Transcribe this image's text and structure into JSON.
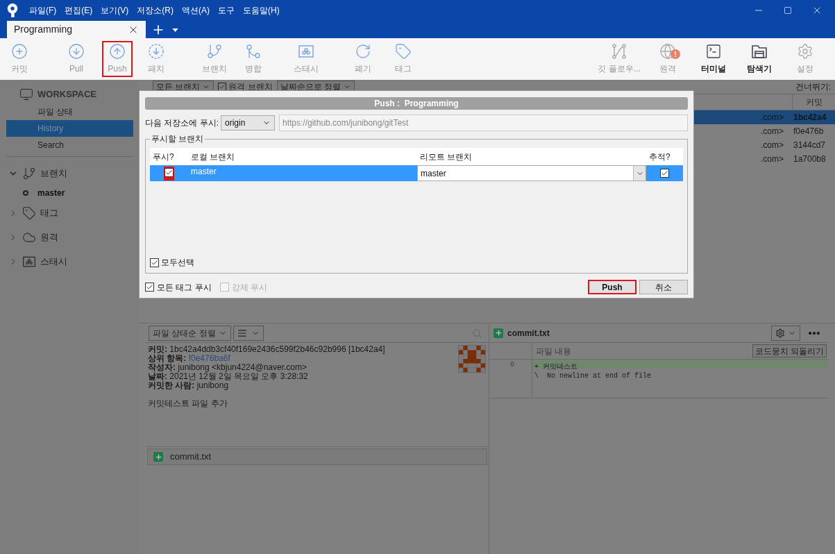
{
  "menu": [
    "파일(F)",
    "편집(E)",
    "보기(V)",
    "저장소(R)",
    "액션(A)",
    "도구",
    "도움말(H)"
  ],
  "tab": {
    "label": "Programming"
  },
  "toolbar": {
    "left": [
      {
        "kind": "commit",
        "label": "커밋",
        "active": false,
        "marked": false
      },
      {
        "kind": "pull",
        "label": "Pull",
        "active": false,
        "marked": false
      },
      {
        "kind": "push",
        "label": "Push",
        "active": false,
        "marked": true
      },
      {
        "kind": "fetch",
        "label": "패치",
        "active": false,
        "marked": false
      },
      {
        "kind": "branch",
        "label": "브랜치",
        "active": false,
        "marked": false
      },
      {
        "kind": "merge",
        "label": "병합",
        "active": false,
        "marked": false
      },
      {
        "kind": "stash",
        "label": "스태시",
        "active": false,
        "marked": false
      },
      {
        "kind": "discard",
        "label": "폐기",
        "active": false,
        "marked": false
      },
      {
        "kind": "tag",
        "label": "태그",
        "active": false,
        "marked": false
      }
    ],
    "right": [
      {
        "kind": "gitflow",
        "label": "깃 플로우...",
        "active": false
      },
      {
        "kind": "remote",
        "label": "원격",
        "active": false,
        "badge": "!"
      },
      {
        "kind": "terminal",
        "label": "터미널",
        "active": true
      },
      {
        "kind": "explorer",
        "label": "탐색기",
        "active": true
      },
      {
        "kind": "settings",
        "label": "설정",
        "active": false
      }
    ]
  },
  "sidebar": {
    "workspace": {
      "title": "WORKSPACE",
      "items": [
        {
          "label": "파일 상태",
          "selected": false
        },
        {
          "label": "History",
          "selected": true
        },
        {
          "label": "Search",
          "selected": false
        }
      ]
    },
    "sections": [
      {
        "kind": "branch",
        "label": "브랜치",
        "expanded": true,
        "children": [
          {
            "label": "master",
            "current": true
          }
        ]
      },
      {
        "kind": "tag",
        "label": "태그",
        "expanded": false
      },
      {
        "kind": "remote",
        "label": "원격",
        "expanded": false
      },
      {
        "kind": "stash",
        "label": "스태시",
        "expanded": false
      }
    ]
  },
  "filter_bar": {
    "branches": "모든 브랜치",
    "remote_branches": {
      "label": "원격 브랜치",
      "checked": true
    },
    "sort": "날짜순으로 정렬",
    "jump_label": "건너뛰기:"
  },
  "commit_list": {
    "column": "커밋",
    "rows": [
      {
        "author": ".com>",
        "hash": "1bc42a4",
        "selected": true
      },
      {
        "author": ".com>",
        "hash": "f0e476b",
        "selected": false
      },
      {
        "author": ".com>",
        "hash": "3144cd7",
        "selected": false
      },
      {
        "author": ".com>",
        "hash": "1a700b8",
        "selected": false
      }
    ]
  },
  "file_panel": {
    "sort": "파일 상태순 정렬",
    "details": [
      {
        "label": "커밋:",
        "value": "1bc42a4ddb3cf40f169e2436c599f2b46c92b996 [1bc42a4]",
        "kind": "text"
      },
      {
        "label": "상위 항목:",
        "value": "f0e476ba6f",
        "kind": "link"
      },
      {
        "label": "작성자:",
        "value": "junibong <kbjun4224@naver.com>",
        "kind": "text"
      },
      {
        "label": "날짜:",
        "value": "2021년 12월 2일 목요일 오후 3:28:32",
        "kind": "text"
      },
      {
        "label": "커밋한 사람:",
        "value": "junibong",
        "kind": "text"
      }
    ],
    "message": "커밋테스트 파일 추가",
    "files": [
      {
        "name": "commit.txt"
      }
    ]
  },
  "diff": {
    "file": "commit.txt",
    "heading": "파일 내용",
    "revert_button": "코드뭉치 되돌리기",
    "lines": [
      {
        "number": "0",
        "text": "+ 커밋테스트",
        "kind": "added"
      },
      {
        "text": "\\  No newline at end of file",
        "kind": "context"
      }
    ]
  },
  "dialog": {
    "title": "Push :  Programming",
    "remote_label": "다음 저장소에 푸시:",
    "remote": "origin",
    "url": "https://github.com/junibong/gitTest",
    "group": "푸시할 브랜치",
    "columns": [
      "푸시?",
      "로컬 브랜치",
      "리모트 브랜치",
      "추적?"
    ],
    "rows": [
      {
        "push": true,
        "push_marked": true,
        "local": "master",
        "remote": "master",
        "track": true,
        "selected": true
      }
    ],
    "select_all": {
      "label": "모두선택",
      "checked": true
    },
    "options": [
      {
        "label": "모든 태그 푸시",
        "checked": true,
        "disabled": false
      },
      {
        "label": "강제 푸시",
        "checked": false,
        "disabled": true
      }
    ],
    "buttons": [
      {
        "label": "Push",
        "kind": "primary",
        "marked": true
      },
      {
        "label": "취소",
        "kind": "cancel",
        "marked": false
      }
    ]
  }
}
